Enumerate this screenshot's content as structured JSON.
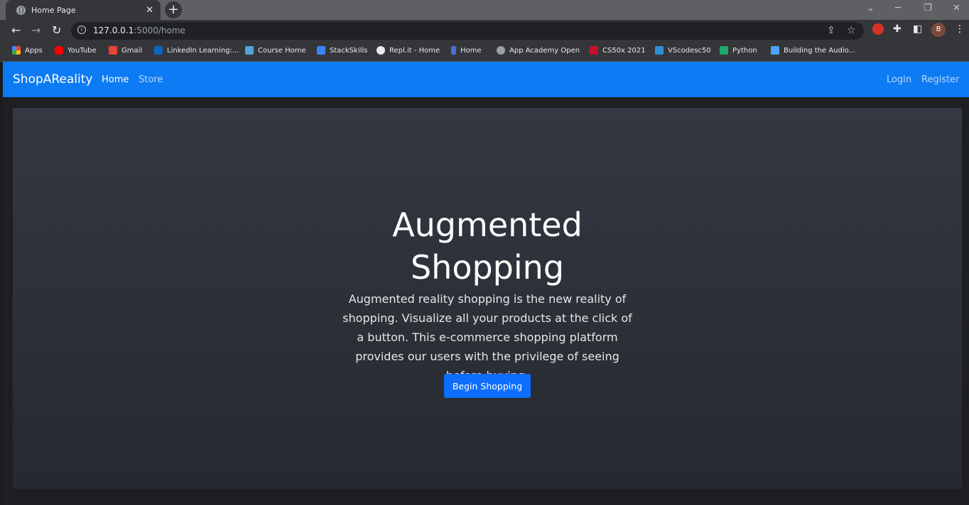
{
  "browser": {
    "tab_title": "Home Page",
    "tab_close": "✕",
    "new_tab": "+",
    "url_host": "127.0.0.1",
    "url_path": ":5000/home",
    "profile_initial": "B",
    "window_controls": [
      "⌄",
      "─",
      "❐",
      "✕"
    ]
  },
  "bookmarks": [
    {
      "label": "Apps",
      "icon": "apps-grid-icon",
      "color": "#ea4335"
    },
    {
      "label": "YouTube",
      "icon": "youtube-icon",
      "color": "#ff0000"
    },
    {
      "label": "Gmail",
      "icon": "gmail-icon",
      "color": "#ea4335"
    },
    {
      "label": "LinkedIn Learning:...",
      "icon": "linkedin-icon",
      "color": "#0a66c2"
    },
    {
      "label": "Course Home",
      "icon": "course-icon",
      "color": "#4fa3d8"
    },
    {
      "label": "StackSkills",
      "icon": "stackskills-icon",
      "color": "#3b82f6"
    },
    {
      "label": "Repl.it - Home",
      "icon": "replit-icon",
      "color": "#e8eaed"
    },
    {
      "label": "Home",
      "icon": "home-bookmark-icon",
      "color": "#4a6fdc"
    },
    {
      "label": "App Academy Open",
      "icon": "globe-icon",
      "color": "#9aa0a6"
    },
    {
      "label": "CS50x 2021",
      "icon": "cs50-icon",
      "color": "#c8102e"
    },
    {
      "label": "VScodesc50",
      "icon": "vscode-icon",
      "color": "#2b8fd6"
    },
    {
      "label": "Python",
      "icon": "python-icon",
      "color": "#1ea86b"
    },
    {
      "label": "Building the Audio...",
      "icon": "pinwheel-icon",
      "color": "#4fa3f7"
    }
  ],
  "navbar": {
    "brand": "ShopAReality",
    "links": [
      "Home",
      "Store"
    ],
    "auth": [
      "Login",
      "Register"
    ],
    "accent": "#0d7bf3"
  },
  "hero": {
    "title_line1": "Augmented",
    "title_line2": "Shopping",
    "text": "Augmented reality shopping is the new reality of shopping. Visualize all your products at the click of a button. This e-commerce shopping platform provides our users with the privilege of seeing before buying.",
    "button": "Begin Shopping",
    "button_color": "#0d6efd"
  }
}
